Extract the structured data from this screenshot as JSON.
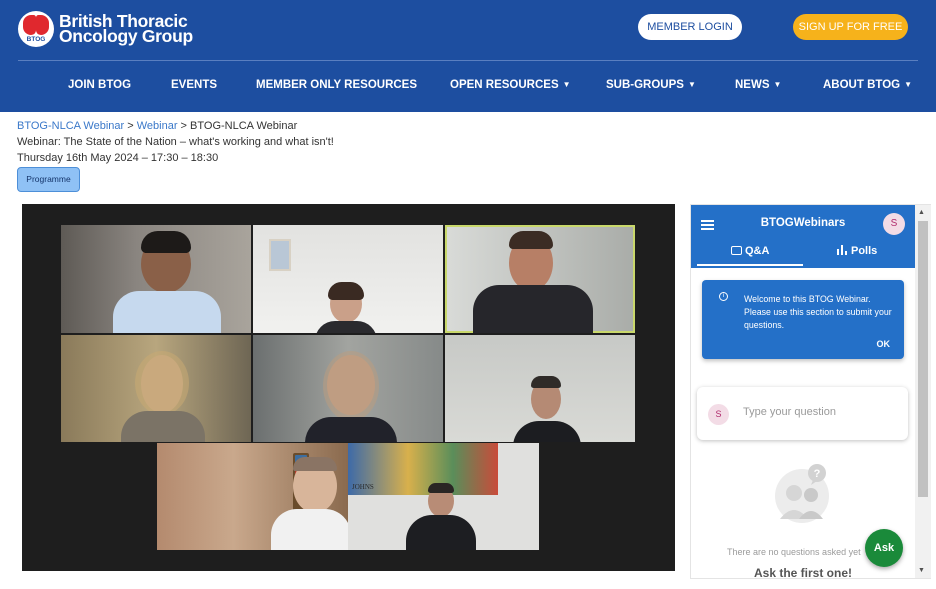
{
  "site": {
    "logo_line1": "British Thoracic",
    "logo_line2": "Oncology Group",
    "logo_mark_text": "BTOG",
    "member_login": "MEMBER LOGIN",
    "sign_up": "SIGN UP FOR FREE",
    "colors": {
      "header_bg": "#1d4ea0",
      "signup_bg": "#f6b21b",
      "panel_blue": "#2470c8",
      "ask_green": "#1a8a3a"
    }
  },
  "nav": [
    {
      "label": "JOIN BTOG",
      "dropdown": false
    },
    {
      "label": "EVENTS",
      "dropdown": false
    },
    {
      "label": "MEMBER ONLY RESOURCES",
      "dropdown": false
    },
    {
      "label": "OPEN RESOURCES",
      "dropdown": true
    },
    {
      "label": "SUB-GROUPS",
      "dropdown": true
    },
    {
      "label": "NEWS",
      "dropdown": true
    },
    {
      "label": "ABOUT BTOG",
      "dropdown": true
    }
  ],
  "breadcrumb": {
    "item1": "BTOG-NLCA Webinar",
    "sep1": " > ",
    "item2": "Webinar",
    "sep2": " > ",
    "current": "BTOG-NLCA Webinar"
  },
  "event": {
    "title": "Webinar: The State of the Nation – what's working and what isn't!",
    "datetime": "Thursday 16th May 2024 – 17:30 – 18:30",
    "programme_button": "Programme"
  },
  "video": {
    "participant_count": 8,
    "poster_text": "JOHNS"
  },
  "qa_panel": {
    "title": "BTOGWebinars",
    "user_initial": "S",
    "tabs": [
      {
        "label": "Q&A",
        "icon": "chat-bubbles-icon",
        "selected": true
      },
      {
        "label": "Polls",
        "icon": "bar-chart-icon",
        "selected": false
      }
    ],
    "welcome_message": "Welcome to this BTOG Webinar. Please use this section to submit your questions.",
    "welcome_ok": "OK",
    "input_initial": "S",
    "input_placeholder": "Type your question",
    "empty_text": "There are no questions asked yet",
    "empty_cta": "Ask the first one!",
    "ask_button": "Ask"
  }
}
